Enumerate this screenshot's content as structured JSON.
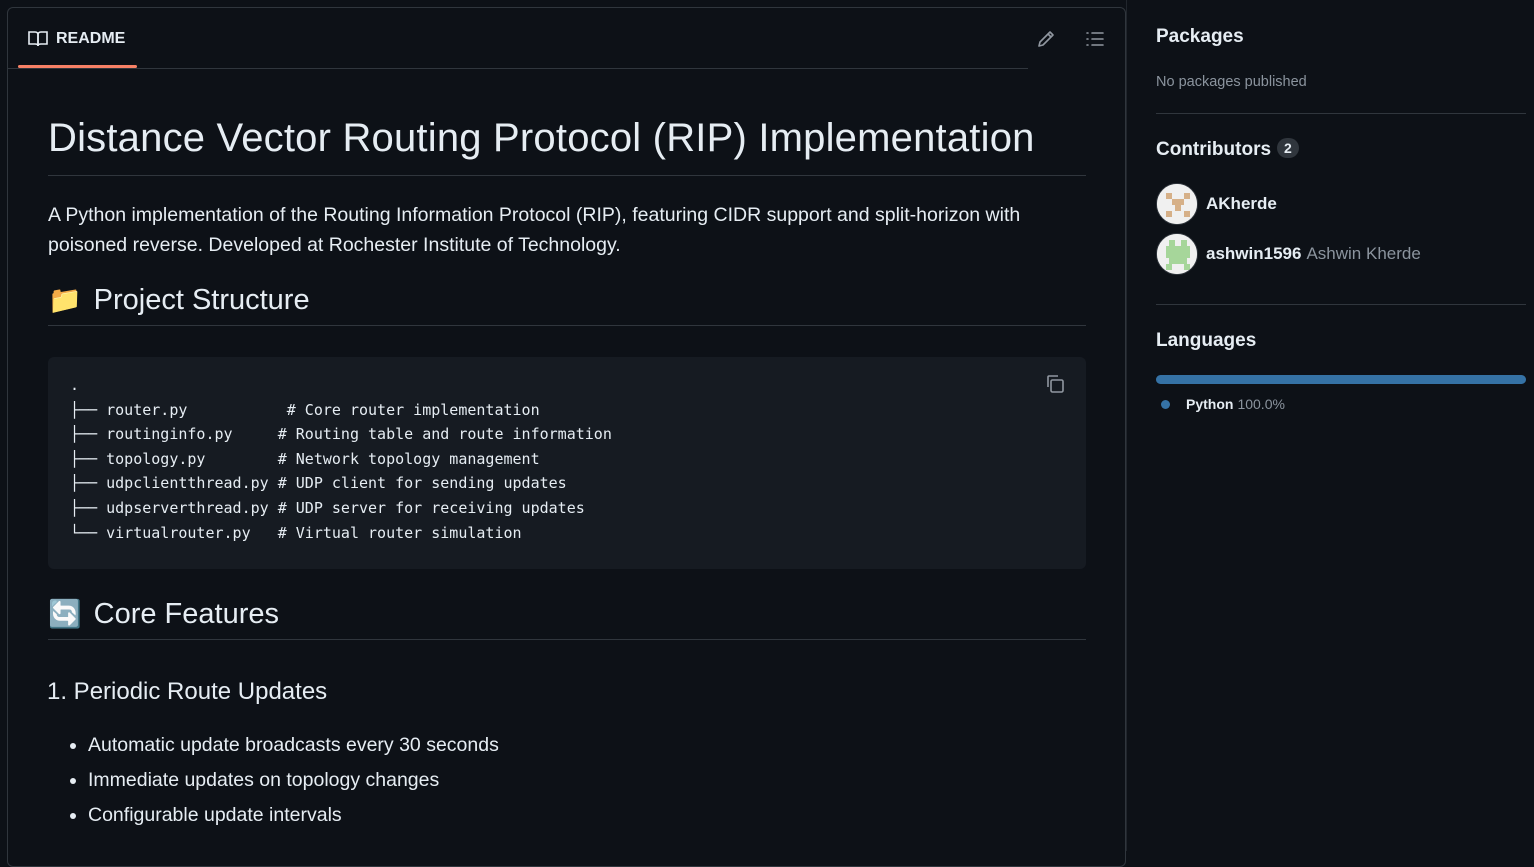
{
  "readme": {
    "tab_label": "README",
    "edit_icon": "pencil-icon",
    "outline_icon": "list-icon"
  },
  "content": {
    "title": "Distance Vector Routing Protocol (RIP) Implementation",
    "intro": "A Python implementation of the Routing Information Protocol (RIP), featuring CIDR support and split-horizon with poisoned reverse. Developed at Rochester Institute of Technology.",
    "project_structure": {
      "emoji": "📁",
      "heading": "Project Structure",
      "code_lines": [
        ".",
        "├── router.py           # Core router implementation",
        "├── routinginfo.py     # Routing table and route information",
        "├── topology.py        # Network topology management",
        "├── udpclientthread.py # UDP client for sending updates",
        "├── udpserverthread.py # UDP server for receiving updates",
        "└── virtualrouter.py   # Virtual router simulation"
      ],
      "copy_icon": "copy-icon"
    },
    "core_features": {
      "emoji": "🔄",
      "heading": "Core Features"
    },
    "periodic": {
      "heading": "1. Periodic Route Updates",
      "items": [
        "Automatic update broadcasts every 30 seconds",
        "Immediate updates on topology changes",
        "Configurable update intervals"
      ]
    }
  },
  "sidebar": {
    "packages": {
      "heading": "Packages",
      "empty_text": "No packages published"
    },
    "contributors": {
      "heading": "Contributors",
      "count": "2",
      "people": [
        {
          "login": "AKherde",
          "name": ""
        },
        {
          "login": "ashwin1596",
          "name": "Ashwin Kherde"
        }
      ]
    },
    "languages": {
      "heading": "Languages",
      "items": [
        {
          "name": "Python",
          "percent": "100.0%",
          "color": "#3572a5",
          "share": 1.0
        }
      ]
    }
  },
  "colors": {
    "accent_underline": "#f78166",
    "python": "#3572a5",
    "background": "#0d1117",
    "code_bg": "#161b22"
  }
}
